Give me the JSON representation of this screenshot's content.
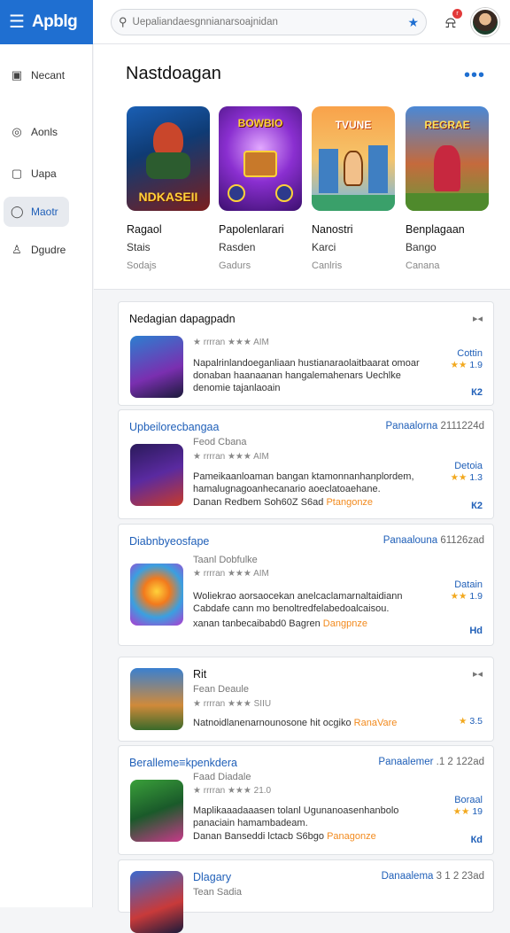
{
  "app": {
    "name": "Apblg"
  },
  "search": {
    "placeholder": "Uepaliandaesgnnianarsoajnidan",
    "value": ""
  },
  "notifications": {
    "badge": "r"
  },
  "sidebar": {
    "items": [
      {
        "label": "Necant",
        "icon": "inbox-icon"
      },
      {
        "label": "Aonls",
        "icon": "compass-icon"
      },
      {
        "label": "Uapa",
        "icon": "page-icon"
      },
      {
        "label": "Maotr",
        "icon": "circle-icon",
        "active": true
      },
      {
        "label": "Dgudre",
        "icon": "user-icon"
      }
    ]
  },
  "featured": {
    "title": "Nastdoagan",
    "more": "•••",
    "games": [
      {
        "art_text": "NDKASEII",
        "t1": "Ragaol",
        "t2": "Stais",
        "t3": "Sodajs"
      },
      {
        "art_text": "BOWBIO",
        "t1": "Papolenlarari",
        "t2": "Rasden",
        "t3": "Gadurs"
      },
      {
        "art_text": "TVUNE",
        "t1": "Nanostri",
        "t2": "Karci",
        "t3": "Canlris"
      },
      {
        "art_text": "REGRAE",
        "t1": "Benplagaan",
        "t2": "Bango",
        "t3": "Canana"
      }
    ]
  },
  "cards": [
    {
      "title": "Nedagian dapagpadn",
      "right": "",
      "right_num": "",
      "sub": "",
      "rating": "★ rrrran ★★★ AIM",
      "desc": "Napalrinlandoeganliaan hustianaraolaitbaarat omoar donaban haanaanan hangalemahenars Uechlke denomie tajanlaoain",
      "tag": "",
      "side_label": "Cottin",
      "side_stars": "★★",
      "side_rate": "1.9",
      "side_btn": "К2",
      "art": "MYGS"
    },
    {
      "title": "Upbeilorecbangaa",
      "right": "Panaalorna",
      "right_num": "2111224d",
      "sub": "Feod Cbana",
      "rating": "★ rrrran ★★★ AIM",
      "desc": "Pameikaanloaman bangan ktamonnanhanplordem, hamalugnagoanhecanario aoeclatoaehane.",
      "desc2": "Danan Redbem Soh60Z S6ad",
      "tag": "Ptangonze",
      "side_label": "Detoia",
      "side_stars": "★★",
      "side_rate": "1.3",
      "side_btn": "К2",
      "art": "NDAKG"
    },
    {
      "title": "Diabnbyeosfape",
      "right": "Panaalouna",
      "right_num": "61126zad",
      "sub": "Taanl Dobfulke",
      "rating": "★ rrrran ★★★ AIM",
      "desc": "Woliekrao aorsaocekan anelcaclamarnaltaidiann Cabdafe cann mo benoltredfelabedoalcaisou.",
      "desc2": "xanan tanbecaibabd0 Bagren",
      "tag": "Dangpnze",
      "side_label": "Datain",
      "side_stars": "★★",
      "side_rate": "1.9",
      "side_btn": "Нd",
      "art": "SOBIUS"
    },
    {
      "title": "Rit",
      "right": "",
      "right_num": "",
      "sub": "Fean Deaule",
      "rating": "★ rrrran ★★★ SIIU",
      "desc": "Natnoidlanenarnounosone hit ocgiko",
      "desc2": "",
      "tag": "RanaVare",
      "side_label": "",
      "side_stars": "★",
      "side_rate": "3.5",
      "side_btn": "",
      "art": "DIKBE"
    },
    {
      "title": "Beralleme≡kpenkdera",
      "right": "Panaalemer",
      "right_num": ".1 2 122ad",
      "sub": "Faad Diadale",
      "rating": "★ rrrran ★★★ 21.0",
      "desc": "Maplikaaadaaasen tolanl Ugunanoasenhanbolo panaciain hamambadeam.",
      "desc2": "Danan Banseddi lctacb S6bgo",
      "tag": "Panagonze",
      "side_label": "Boraal",
      "side_stars": "★★",
      "side_rate": "19",
      "side_btn": "Кd",
      "art": "BUKAS"
    },
    {
      "title": "Dlagary",
      "right": "Danaalema",
      "right_num": "3 1 2 23ad",
      "sub": "Tean Sadia",
      "rating": "",
      "desc": "",
      "desc2": "",
      "tag": "",
      "side_label": "",
      "side_stars": "",
      "side_rate": "",
      "side_btn": "",
      "art": ""
    }
  ],
  "colors": {
    "brand": "#1f6fd1",
    "accent_blue": "#1f5fb8",
    "star": "#f2a81d",
    "tag_orange": "#f28a1d"
  }
}
